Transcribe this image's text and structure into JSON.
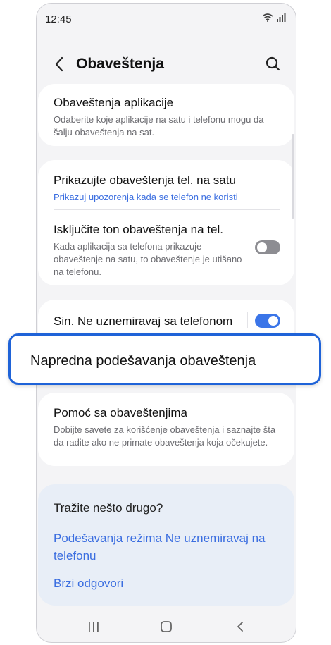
{
  "status_bar": {
    "time": "12:45",
    "icons": [
      "wifi-icon",
      "signal-icon"
    ]
  },
  "header": {
    "title": "Obaveštenja",
    "back_icon": "chevron-left-icon",
    "search_icon": "search-icon"
  },
  "cards": {
    "app_notifications": {
      "title": "Obaveštenja aplikacije",
      "subtitle": "Odaberite koje aplikacije na satu i telefonu mogu da šalju obaveštenja na sat."
    },
    "show_phone": {
      "title": "Prikazujte obaveštenja tel. na satu",
      "subtitle": "Prikazuj upozorenja kada se telefon ne koristi"
    },
    "mute_phone": {
      "title": "Isključite ton obaveštenja na tel.",
      "subtitle": "Kada aplikacija sa telefona prikazuje obaveštenje na satu, to obaveštenje je utišano na telefonu.",
      "toggle": "off"
    },
    "dnd_sync": {
      "title": "Sin. Ne uznemiravaj sa telefonom",
      "toggle": "on"
    },
    "advanced": {
      "title": "Napredna podešavanja obaveštenja"
    },
    "help": {
      "title": "Pomoć sa obaveštenjima",
      "subtitle": "Dobijte savete za korišćenje obaveštenja i saznajte šta da radite ako ne primate obaveštenja koja očekujete."
    }
  },
  "looking_for": {
    "title": "Tražite nešto drugo?",
    "links": [
      "Podešavanja režima Ne uznemiravaj na telefonu",
      "Brzi odgovori"
    ]
  },
  "navbar": {
    "icons": [
      "recent-apps-icon",
      "home-icon",
      "back-icon"
    ]
  },
  "colors": {
    "accent": "#3b75e8",
    "link": "#3b6ee0",
    "highlight_border": "#1f63d8"
  }
}
